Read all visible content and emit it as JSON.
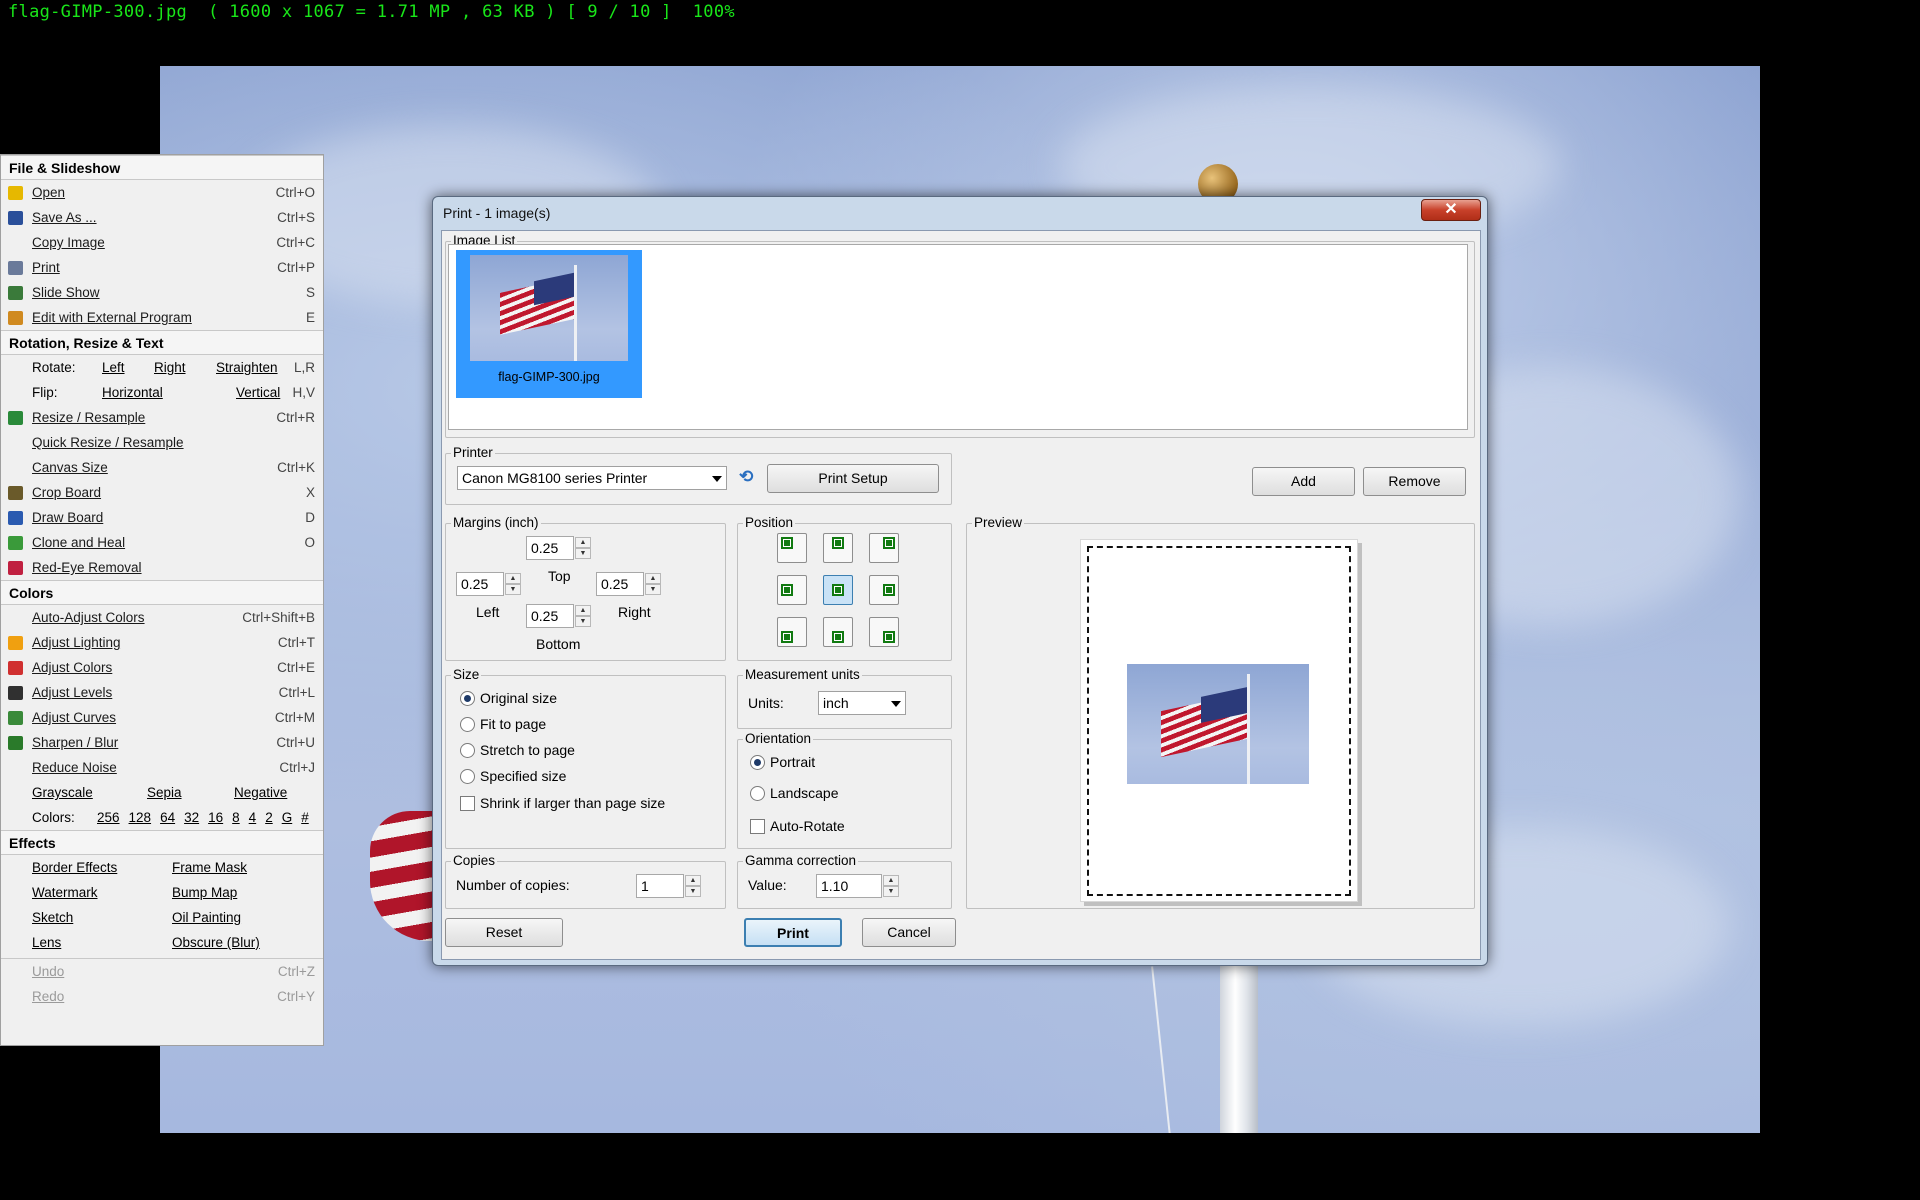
{
  "status_bar": "flag-GIMP-300.jpg  ( 1600 x 1067 = 1.71 MP , 63 KB ) [ 9 / 10 ]  100%",
  "menu": {
    "file": {
      "title": "File & Slideshow",
      "items": [
        {
          "label": "Open",
          "shortcut": "Ctrl+O",
          "icon": "open-folder-icon"
        },
        {
          "label": "Save As ...",
          "shortcut": "Ctrl+S",
          "icon": "floppy-disk-icon"
        },
        {
          "label": "Copy Image",
          "shortcut": "Ctrl+C",
          "icon": ""
        },
        {
          "label": "Print",
          "shortcut": "Ctrl+P",
          "icon": "printer-icon"
        },
        {
          "label": "Slide Show",
          "shortcut": "S",
          "icon": "slideshow-icon"
        },
        {
          "label": "Edit with External Program",
          "shortcut": "E",
          "icon": "palette-icon"
        }
      ]
    },
    "rotation": {
      "title": "Rotation, Resize & Text",
      "rotate_label": "Rotate:",
      "rotate_left": "Left",
      "rotate_right": "Right",
      "rotate_straighten": "Straighten",
      "rotate_shortcut": "L,R",
      "flip_label": "Flip:",
      "flip_horizontal": "Horizontal",
      "flip_vertical": "Vertical",
      "flip_shortcut": "H,V",
      "items": [
        {
          "label": "Resize / Resample",
          "shortcut": "Ctrl+R",
          "icon": "resize-icon"
        },
        {
          "label": "Quick Resize / Resample",
          "shortcut": "",
          "icon": ""
        },
        {
          "label": "Canvas Size",
          "shortcut": "Ctrl+K",
          "icon": ""
        },
        {
          "label": "Crop Board",
          "shortcut": "X",
          "icon": "crop-icon"
        },
        {
          "label": "Draw Board",
          "shortcut": "D",
          "icon": "draw-icon"
        },
        {
          "label": "Clone and Heal",
          "shortcut": "O",
          "icon": "clone-icon"
        },
        {
          "label": "Red-Eye Removal",
          "shortcut": "",
          "icon": "red-eye-icon"
        }
      ]
    },
    "colors": {
      "title": "Colors",
      "items": [
        {
          "label": "Auto-Adjust Colors",
          "shortcut": "Ctrl+Shift+B",
          "icon": ""
        },
        {
          "label": "Adjust Lighting",
          "shortcut": "Ctrl+T",
          "icon": "sun-icon"
        },
        {
          "label": "Adjust Colors",
          "shortcut": "Ctrl+E",
          "icon": "color-squares-icon"
        },
        {
          "label": "Adjust Levels",
          "shortcut": "Ctrl+L",
          "icon": "levels-icon"
        },
        {
          "label": "Adjust Curves",
          "shortcut": "Ctrl+M",
          "icon": "curves-icon"
        },
        {
          "label": "Sharpen / Blur",
          "shortcut": "Ctrl+U",
          "icon": "sharpen-icon"
        },
        {
          "label": "Reduce Noise",
          "shortcut": "Ctrl+J",
          "icon": ""
        }
      ],
      "grayscale": "Grayscale",
      "sepia": "Sepia",
      "negative": "Negative",
      "colors_label": "Colors:",
      "depths": [
        "256",
        "128",
        "64",
        "32",
        "16",
        "8",
        "4",
        "2",
        "G",
        "#"
      ]
    },
    "effects": {
      "title": "Effects",
      "left": [
        "Border Effects",
        "Watermark",
        "Sketch",
        "Lens"
      ],
      "right": [
        "Frame Mask",
        "Bump Map",
        "Oil Painting",
        "Obscure (Blur)"
      ]
    },
    "undo": {
      "label": "Undo",
      "shortcut": "Ctrl+Z"
    },
    "redo": {
      "label": "Redo",
      "shortcut": "Ctrl+Y"
    }
  },
  "dialog": {
    "title": "Print  -  1 image(s)",
    "close": "✕",
    "image_list": {
      "legend": "Image List",
      "items": [
        {
          "name": "flag-GIMP-300.jpg"
        }
      ]
    },
    "printer": {
      "legend": "Printer",
      "selected": "Canon MG8100 series Printer",
      "setup": "Print Setup"
    },
    "add": "Add",
    "remove": "Remove",
    "margins": {
      "legend": "Margins (inch)",
      "top": "0.25",
      "left": "0.25",
      "right": "0.25",
      "bottom": "0.25",
      "top_label": "Top",
      "left_label": "Left",
      "right_label": "Right",
      "bottom_label": "Bottom"
    },
    "position": {
      "legend": "Position",
      "selected": "center"
    },
    "preview": {
      "legend": "Preview"
    },
    "size": {
      "legend": "Size",
      "options": [
        "Original size",
        "Fit to page",
        "Stretch to page",
        "Specified size"
      ],
      "selected": "Original size",
      "shrink": "Shrink if larger than page size"
    },
    "measurement": {
      "legend": "Measurement units",
      "units_label": "Units:",
      "units": "inch"
    },
    "orientation": {
      "legend": "Orientation",
      "portrait": "Portrait",
      "landscape": "Landscape",
      "selected": "Portrait",
      "auto_rotate": "Auto-Rotate"
    },
    "copies": {
      "legend": "Copies",
      "label": "Number of copies:",
      "value": "1"
    },
    "gamma": {
      "legend": "Gamma correction",
      "label": "Value:",
      "value": "1.10"
    },
    "reset": "Reset",
    "print": "Print",
    "cancel": "Cancel"
  },
  "colors": {
    "status_text": "#19e619",
    "dialog_frame": "#c9d9ea",
    "selection": "#3399ff"
  }
}
